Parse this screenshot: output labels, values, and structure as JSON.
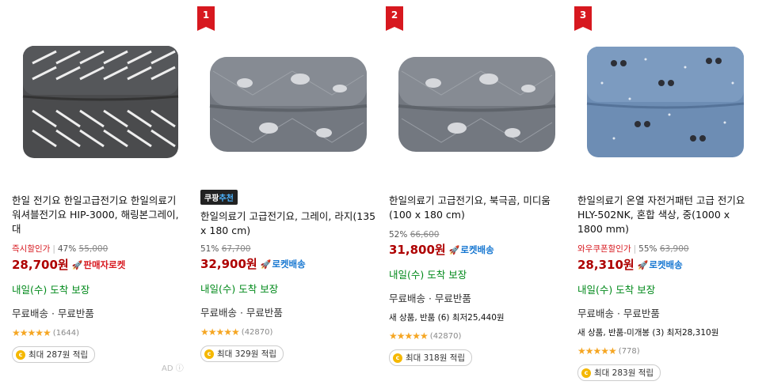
{
  "products": [
    {
      "rank": "",
      "recommend_badge": {
        "label": "",
        "accent": ""
      },
      "name": "한일 전기요 한일고급전기요 한일의료기 워셔블전기요 HIP-3000, 해링본그레이, 대",
      "discount_tag": "즉시할인가",
      "discount_percent": "47%",
      "original_price": "55,000",
      "price": "28,700원",
      "rocket_label": "판매자로켓",
      "rocket_color": "red",
      "delivery": "내일(수) 도착 보장",
      "shipping": "무료배송 · 무료반품",
      "other_sellers": "",
      "rating_value": 4.5,
      "review_count": "(1644)",
      "points": "최대 287원 적립",
      "ad_label": "AD"
    },
    {
      "rank": "1",
      "recommend_badge": {
        "label": "쿠팡",
        "accent": "추천"
      },
      "name": "한일의료기 고급전기요, 그레이, 라지(135 x 180 cm)",
      "discount_tag": "",
      "discount_percent": "51%",
      "original_price": "67,700",
      "price": "32,900원",
      "rocket_label": "로켓배송",
      "rocket_color": "blue",
      "delivery": "내일(수) 도착 보장",
      "shipping": "무료배송 · 무료반품",
      "other_sellers": "",
      "rating_value": 4.5,
      "review_count": "(42870)",
      "points": "최대 329원 적립",
      "ad_label": ""
    },
    {
      "rank": "2",
      "recommend_badge": {
        "label": "",
        "accent": ""
      },
      "name": "한일의료기 고급전기요, 북극곰, 미디움 (100 x 180 cm)",
      "discount_tag": "",
      "discount_percent": "52%",
      "original_price": "66,600",
      "price": "31,800원",
      "rocket_label": "로켓배송",
      "rocket_color": "blue",
      "delivery": "내일(수) 도착 보장",
      "shipping": "무료배송 · 무료반품",
      "other_sellers": "새 상품, 반품 (6) 최저25,440원",
      "rating_value": 4.5,
      "review_count": "(42870)",
      "points": "최대 318원 적립",
      "ad_label": ""
    },
    {
      "rank": "3",
      "recommend_badge": {
        "label": "",
        "accent": ""
      },
      "name": "한일의료기 온열 자전거패턴 고급 전기요 HLY-502NK, 혼합 색상, 중(1000 x 1800 mm)",
      "discount_tag": "와우쿠폰할인가",
      "discount_percent": "55%",
      "original_price": "63,900",
      "price": "28,310원",
      "rocket_label": "로켓배송",
      "rocket_color": "blue",
      "delivery": "내일(수) 도착 보장",
      "shipping": "무료배송 · 무료반품",
      "other_sellers": "새 상품, 반품-미개봉 (3) 최저28,310원",
      "rating_value": 4.5,
      "review_count": "(778)",
      "points": "최대 283원 적립",
      "ad_label": ""
    }
  ],
  "colors": {
    "price": "#ae0000",
    "delivery": "#00891a",
    "rank_badge": "#d7181f",
    "rocket_blue": "#1777d1",
    "star": "#f5a623"
  }
}
